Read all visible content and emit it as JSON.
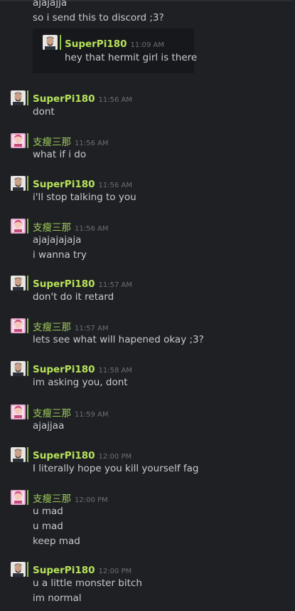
{
  "partial_top": {
    "line1": "ajajajja",
    "line2": "so i send this to discord ;3?",
    "quote": {
      "author": "SuperPi180",
      "time": "11:09 AM",
      "text": "hey that hermit girl is there"
    }
  },
  "messages": [
    {
      "author": "SuperPi180",
      "time": "11:56 AM",
      "lines": [
        "dont"
      ]
    },
    {
      "author": "支瘦三那",
      "time": "11:56 AM",
      "lines": [
        "what if i do"
      ]
    },
    {
      "author": "SuperPi180",
      "time": "11:56 AM",
      "lines": [
        "i'll stop talking to you"
      ]
    },
    {
      "author": "支瘦三那",
      "time": "11:56 AM",
      "lines": [
        "ajajajajaja",
        "i wanna try"
      ]
    },
    {
      "author": "SuperPi180",
      "time": "11:57 AM",
      "lines": [
        "don't do it retard"
      ]
    },
    {
      "author": "支瘦三那",
      "time": "11:57 AM",
      "lines": [
        "lets see what will hapened okay ;3?"
      ]
    },
    {
      "author": "SuperPi180",
      "time": "11:58 AM",
      "lines": [
        "im asking you, dont"
      ]
    },
    {
      "author": "支瘦三那",
      "time": "11:59 AM",
      "lines": [
        "ajajjaa"
      ]
    },
    {
      "author": "SuperPi180",
      "time": "12:00 PM",
      "lines": [
        "I literally hope you kill yourself fag"
      ]
    },
    {
      "author": "支瘦三那",
      "time": "12:00 PM",
      "lines": [
        "u mad",
        "u mad",
        "keep mad"
      ]
    },
    {
      "author": "SuperPi180",
      "time": "12:00 PM",
      "lines": [
        "u a little monster bitch",
        "im normal"
      ]
    }
  ]
}
